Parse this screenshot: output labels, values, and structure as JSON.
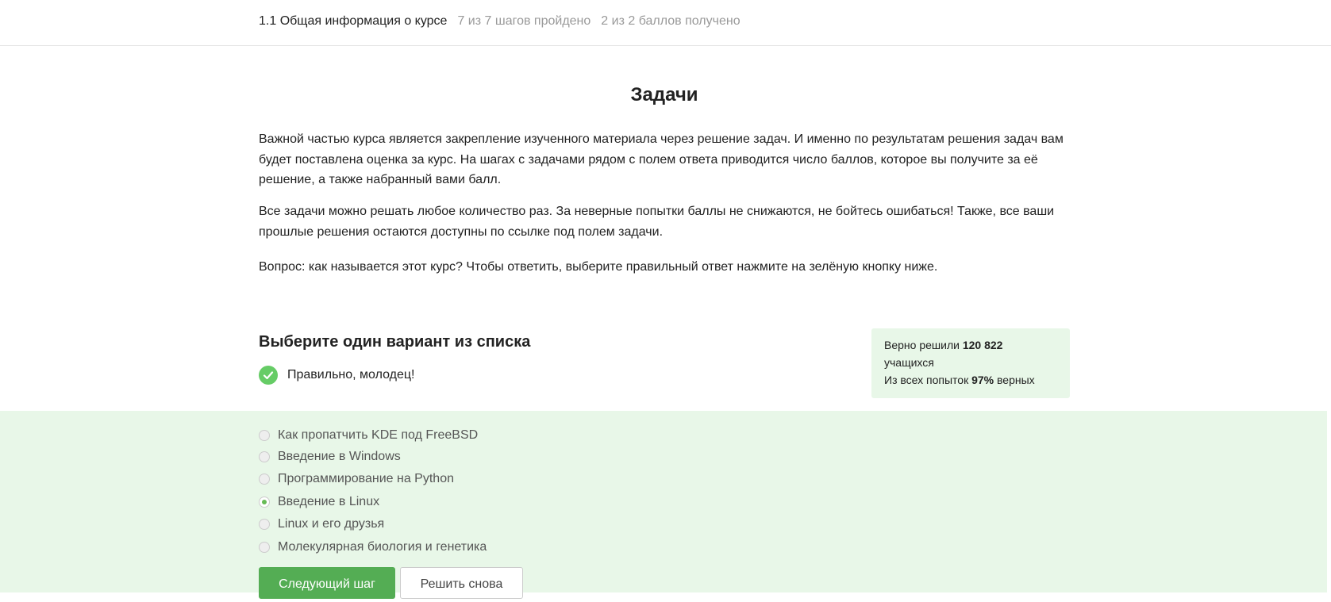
{
  "header": {
    "lesson_title": "1.1 Общая информация о курсе",
    "steps_progress": "7 из 7 шагов пройдено",
    "points_progress": "2 из 2 баллов  получено"
  },
  "step": {
    "title": "Задачи",
    "paragraphs": [
      "Важной частью курса является закрепление изученного материала через решение задач. И именно по результатам решения задач вам будет поставлена оценка за курс. На шагах с задачами рядом с полем ответа приводится число баллов, которое вы получите за её решение, а также набранный вами балл.",
      "Все задачи можно решать любое количество раз. За неверные попытки баллы не снижаются, не бойтесь ошибаться! Также, все ваши прошлые решения остаются доступны по ссылке под полем задачи.",
      "Вопрос: как называется этот курс? Чтобы ответить, выберите правильный ответ нажмите на зелёную кнопку ниже."
    ]
  },
  "quiz": {
    "heading": "Выберите один вариант из списка",
    "feedback": "Правильно, молодец!",
    "options": [
      {
        "label": "Как пропатчить KDE под FreeBSD",
        "selected": false
      },
      {
        "label": "Введение в Windows",
        "selected": false
      },
      {
        "label": "Программирование на Python",
        "selected": false
      },
      {
        "label": "Введение в Linux",
        "selected": true
      },
      {
        "label": "Linux и его друзья",
        "selected": false
      },
      {
        "label": "Молекулярная биология и генетика",
        "selected": false
      }
    ],
    "next_button": "Следующий шаг",
    "retry_button": "Решить снова"
  },
  "stats": {
    "solved_prefix": "Верно решили",
    "solved_count": "120 822",
    "solved_suffix": "учащихся",
    "attempts_prefix": "Из всех попыток",
    "attempts_percent": "97%",
    "attempts_suffix": "верных"
  },
  "colors": {
    "accent_green": "#54ad54",
    "check_green": "#66cc66",
    "answer_bg": "#e8f7e8",
    "muted_text": "#999999"
  },
  "icons": {
    "feedback_icon": "check-circle-icon"
  }
}
